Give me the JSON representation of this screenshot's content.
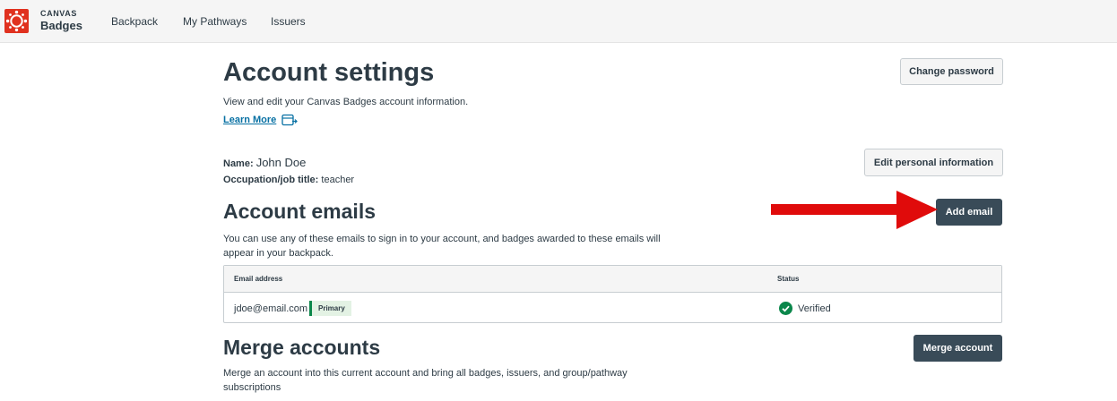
{
  "nav": {
    "logo_line1": "CANVAS",
    "logo_line2": "Badges",
    "links": [
      "Backpack",
      "My Pathways",
      "Issuers"
    ]
  },
  "page": {
    "title": "Account settings",
    "description": "View and edit your Canvas Badges account information.",
    "learn_more": "Learn More",
    "change_password": "Change password"
  },
  "personal": {
    "name_label": "Name:",
    "name_value": "John Doe",
    "occupation_label": "Occupation/job title:",
    "occupation_value": "teacher",
    "edit_button": "Edit personal information"
  },
  "emails": {
    "heading": "Account emails",
    "description_line1": "You can use any of these emails to sign in to your account, and badges awarded to these emails will",
    "description_line2": "appear in your backpack.",
    "add_button": "Add email",
    "columns": [
      "Email address",
      "Status"
    ],
    "rows": [
      {
        "email": "jdoe@email.com",
        "badge": "Primary",
        "status": "Verified"
      }
    ]
  },
  "merge": {
    "heading": "Merge accounts",
    "description_line1": "Merge an account into this current account and bring all badges, issuers, and group/pathway",
    "description_line2": "subscriptions",
    "button": "Merge account"
  },
  "colors": {
    "brand": "#e0311f",
    "dark_button": "#394b58",
    "link": "#0770a3",
    "verified": "#0b874b",
    "annotation_arrow": "#e00b0b"
  }
}
